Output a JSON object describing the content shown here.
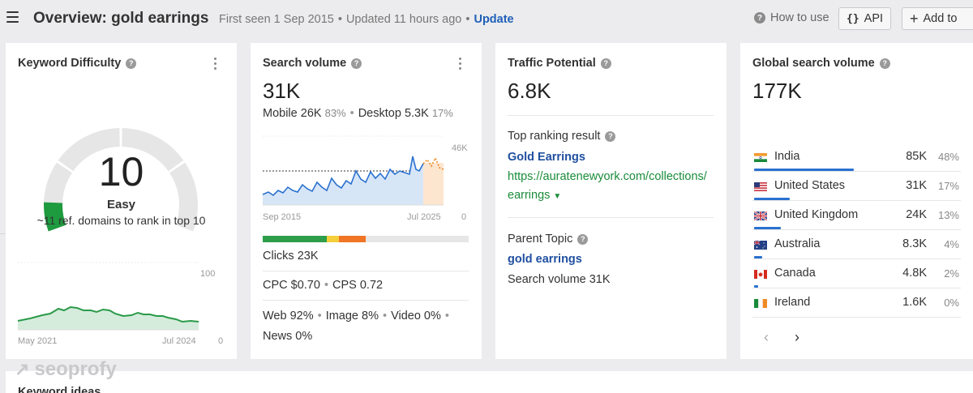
{
  "header": {
    "title": "Overview: gold earrings",
    "first_seen": "First seen 1 Sep 2015",
    "updated": "Updated 11 hours ago",
    "update_link": "Update",
    "how_to_use": "How to use",
    "api_label": "API",
    "add_to_label": "Add to"
  },
  "difficulty": {
    "title": "Keyword Difficulty",
    "value": "10",
    "value_fraction": 0.1,
    "label": "Easy",
    "subtitle": "~11 ref. domains to rank in top 10",
    "chart_start": "May 2021",
    "chart_end": "Jul 2024",
    "chart_max": "100",
    "chart_min": "0",
    "gauge_color": "#1e9a3f"
  },
  "volume": {
    "title": "Search volume",
    "value": "31K",
    "mobile_label": "Mobile",
    "mobile_value": "26K",
    "mobile_pct": "83%",
    "desktop_label": "Desktop",
    "desktop_value": "5.3K",
    "desktop_pct": "17%",
    "chart_start": "Sep 2015",
    "chart_end": "Jul 2025",
    "chart_max": "46K",
    "chart_min": "0",
    "clicks": "Clicks 23K",
    "cpc": "CPC $0.70",
    "cps": "CPS 0.72",
    "web": "Web 92%",
    "image": "Image 8%",
    "video": "Video 0%",
    "news": "News 0%",
    "click_bar": [
      {
        "share": 0.31,
        "color": "#2f9e4a"
      },
      {
        "share": 0.06,
        "color": "#f4cf3a"
      },
      {
        "share": 0.13,
        "color": "#f07524"
      },
      {
        "share": 0.5,
        "color": "#e6e6e6"
      }
    ]
  },
  "traffic": {
    "title": "Traffic Potential",
    "value": "6.8K",
    "top_result_label": "Top ranking result",
    "top_result_title": "Gold Earrings",
    "top_result_url_1": "https://auratenewyork.com/collections/",
    "top_result_url_2": "earrings",
    "parent_topic_label": "Parent Topic",
    "parent_topic": "gold earrings",
    "parent_volume": "Search volume 31K"
  },
  "global": {
    "title": "Global search volume",
    "value": "177K",
    "countries": [
      {
        "name": "India",
        "value": "85K",
        "pct": "48%",
        "share": 0.48
      },
      {
        "name": "United States",
        "value": "31K",
        "pct": "17%",
        "share": 0.17
      },
      {
        "name": "United Kingdom",
        "value": "24K",
        "pct": "13%",
        "share": 0.13
      },
      {
        "name": "Australia",
        "value": "8.3K",
        "pct": "4%",
        "share": 0.04
      },
      {
        "name": "Canada",
        "value": "4.8K",
        "pct": "2%",
        "share": 0.02
      },
      {
        "name": "Ireland",
        "value": "1.6K",
        "pct": "0%",
        "share": 0.0
      }
    ]
  },
  "watermark": "seoprofy",
  "keyword_ideas": "Keyword ideas"
}
